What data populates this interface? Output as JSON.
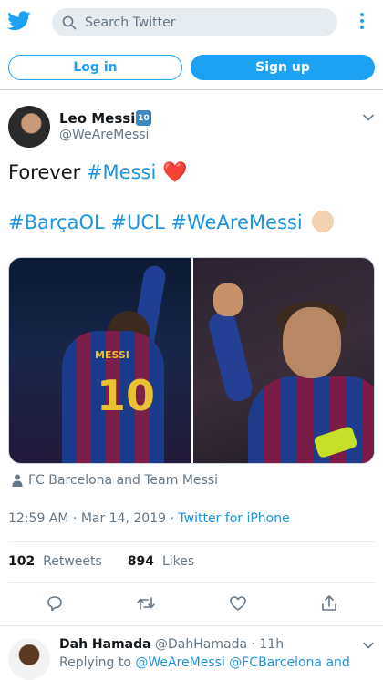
{
  "header": {
    "logo": "twitter-bird-icon",
    "search_placeholder": "Search Twitter",
    "more": "more-vertical-icon"
  },
  "auth": {
    "login_label": "Log in",
    "signup_label": "Sign up"
  },
  "tweet": {
    "author": {
      "name": "Leo Messi",
      "badge": "🔟",
      "handle": "@WeAreMessi"
    },
    "text": {
      "line1_prefix": "Forever ",
      "line1_tag": "#Messi",
      "line1_emoji": "❤️",
      "tags": [
        "#BarçaOL",
        "#UCL",
        "#WeAreMessi"
      ],
      "line2_emoji": "✊🏼"
    },
    "photos": {
      "left_jersey_name": "MESSI",
      "left_jersey_number": "10"
    },
    "tagged_people": "FC Barcelona and Team Messi",
    "time": "12:59 AM",
    "date": "Mar 14, 2019",
    "source": "Twitter for iPhone",
    "retweets_count": "102",
    "retweets_label": "Retweets",
    "likes_count": "894",
    "likes_label": "Likes"
  },
  "reply": {
    "name": "Dah Hamada",
    "handle": "@DahHamada",
    "time": "11h",
    "replying_prefix": "Replying to",
    "replying_to_1": "@WeAreMessi",
    "replying_to_2": "@FCBarcelona",
    "replying_suffix": "and"
  },
  "colors": {
    "accent": "#1da1f2",
    "link": "#1b95e0",
    "muted": "#657786",
    "text": "#14171a"
  }
}
